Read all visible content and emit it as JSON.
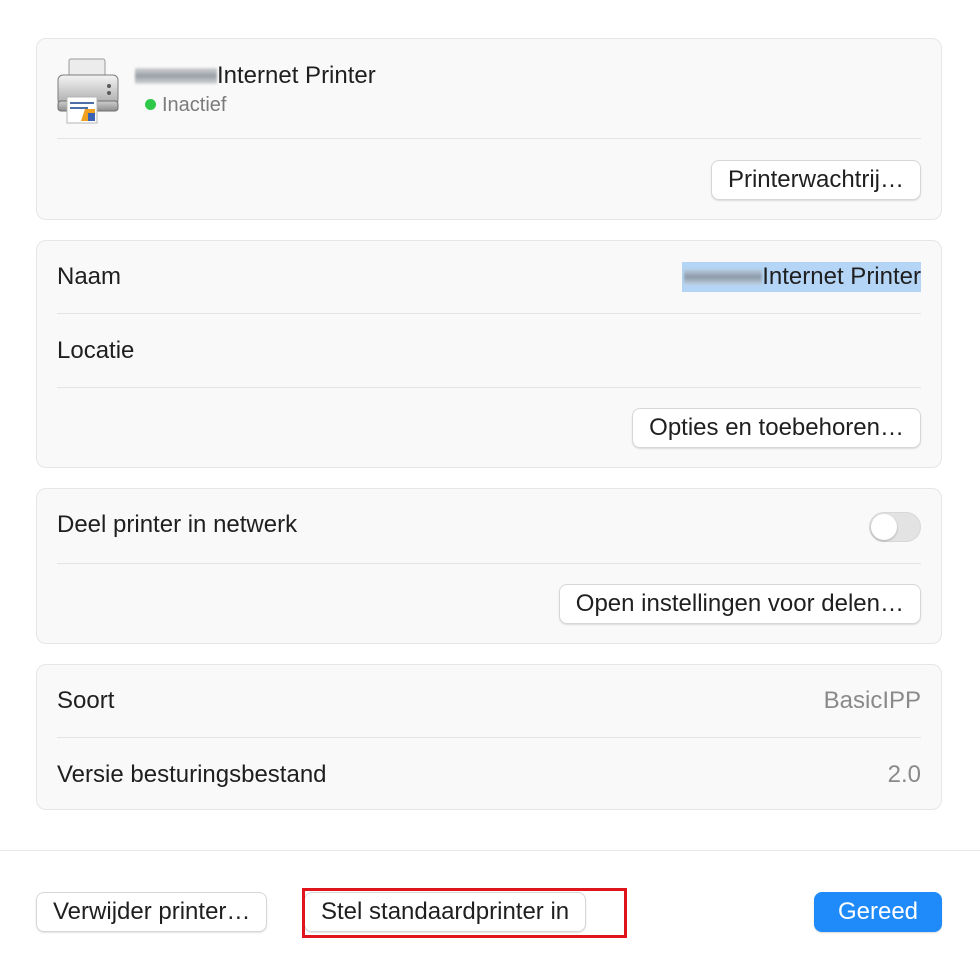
{
  "printer": {
    "name_suffix": "Internet Printer",
    "status": "Inactief",
    "status_color": "#2fc94a",
    "queue_button": "Printerwachtrij…"
  },
  "info": {
    "name_label": "Naam",
    "name_value": "Internet Printer",
    "location_label": "Locatie",
    "location_value": "",
    "options_button": "Opties en toebehoren…"
  },
  "sharing": {
    "share_label": "Deel printer in netwerk",
    "share_enabled": false,
    "settings_button": "Open instellingen voor delen…"
  },
  "details": {
    "type_label": "Soort",
    "type_value": "BasicIPP",
    "driver_label": "Versie besturingsbestand",
    "driver_value": "2.0"
  },
  "footer": {
    "remove_button": "Verwijder printer…",
    "default_button": "Stel standaardprinter in",
    "done_button": "Gereed",
    "accent_color": "#1f8bfa",
    "highlight_color": "#e0141b"
  }
}
